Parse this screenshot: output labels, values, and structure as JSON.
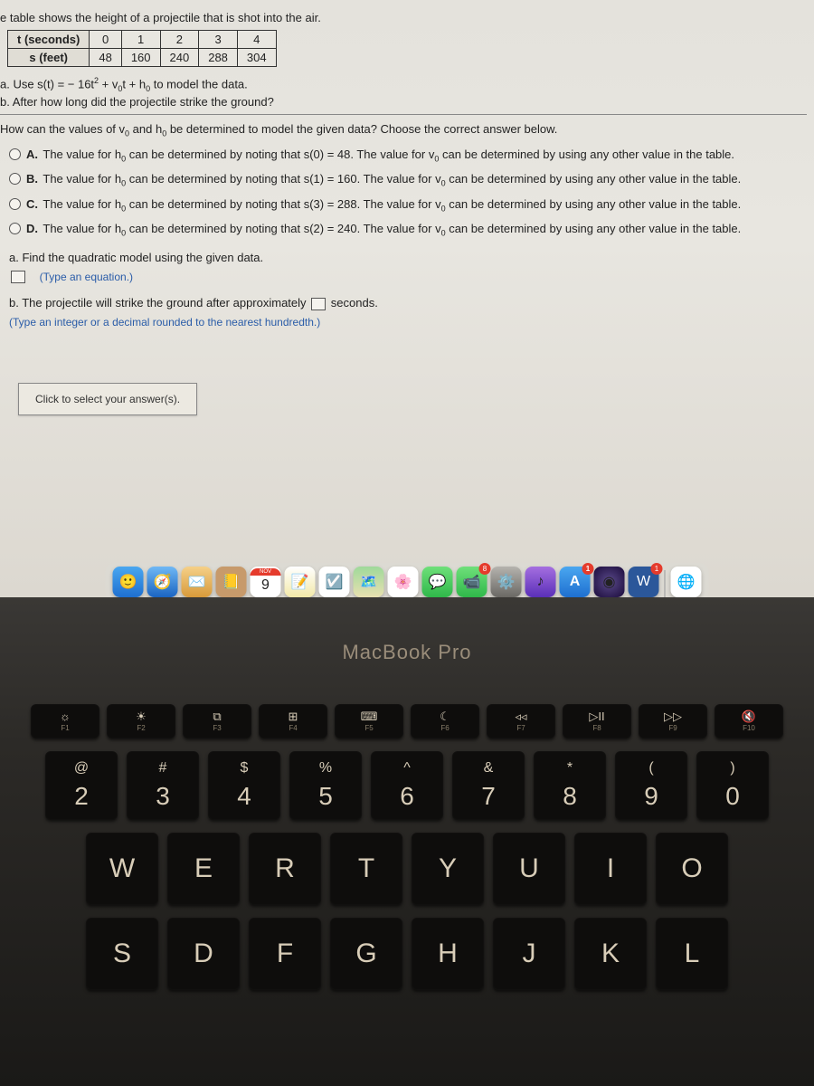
{
  "intro": "e table shows the height of a projectile that is shot into the air.",
  "table": {
    "row1_label": "t (seconds)",
    "row2_label": "s (feet)",
    "cols": [
      "0",
      "1",
      "2",
      "3",
      "4"
    ],
    "vals": [
      "48",
      "160",
      "240",
      "288",
      "304"
    ]
  },
  "part_a_prefix": "a. Use s(t) = − 16t",
  "part_a_mid": " + v",
  "part_a_mid2": "t + h",
  "part_a_suffix": " to model the data.",
  "part_b": "b. After how long did the projectile strike the ground?",
  "question_prefix": "How can the values of v",
  "question_mid": " and h",
  "question_suffix": " be determined to model the given data? Choose the correct answer below.",
  "choices": [
    {
      "l": "A.",
      "p1": "The value for h",
      "p2": " can be determined by noting that s(0) = 48. The value for v",
      "p3": " can be determined by using any other value in the table."
    },
    {
      "l": "B.",
      "p1": "The value for h",
      "p2": " can be determined by noting that s(1) = 160. The value for v",
      "p3": " can be determined by using any other value in the table."
    },
    {
      "l": "C.",
      "p1": "The value for h",
      "p2": " can be determined by noting that s(3) = 288. The value for v",
      "p3": " can be determined by using any other value in the table."
    },
    {
      "l": "D.",
      "p1": "The value for h",
      "p2": " can be determined by noting that s(2) = 240. The value for v",
      "p3": " can be determined by using any other value in the table."
    }
  ],
  "sub_a": "a. Find the quadratic model using the given data.",
  "sub_a_hint": "(Type an equation.)",
  "sub_b_1": "b. The projectile will strike the ground after approximately ",
  "sub_b_2": " seconds.",
  "sub_b_hint": "(Type an integer or a decimal rounded to the nearest hundredth.)",
  "click_msg": "Click to select your answer(s).",
  "zero_sub": "0",
  "two_sup": "2",
  "dock": {
    "cal_month": "NOV",
    "cal_day": "9",
    "badge8": "8",
    "badge1a": "1",
    "badge1b": "1"
  },
  "brand": "MacBook Pro",
  "fkeys": [
    {
      "sym": "☼",
      "lbl": "F1"
    },
    {
      "sym": "☀",
      "lbl": "F2"
    },
    {
      "sym": "⧉",
      "lbl": "F3"
    },
    {
      "sym": "⊞",
      "lbl": "F4"
    },
    {
      "sym": "⌨",
      "lbl": "F5"
    },
    {
      "sym": "☾",
      "lbl": "F6"
    },
    {
      "sym": "◃◃",
      "lbl": "F7"
    },
    {
      "sym": "▷II",
      "lbl": "F8"
    },
    {
      "sym": "▷▷",
      "lbl": "F9"
    },
    {
      "sym": "🔇",
      "lbl": "F10"
    }
  ],
  "numkeys": [
    {
      "t": "@",
      "b": "2"
    },
    {
      "t": "#",
      "b": "3"
    },
    {
      "t": "$",
      "b": "4"
    },
    {
      "t": "%",
      "b": "5"
    },
    {
      "t": "^",
      "b": "6"
    },
    {
      "t": "&",
      "b": "7"
    },
    {
      "t": "*",
      "b": "8"
    },
    {
      "t": "(",
      "b": "9"
    },
    {
      "t": ")",
      "b": "0"
    }
  ],
  "row_qwerty": [
    "W",
    "E",
    "R",
    "T",
    "Y",
    "U",
    "I",
    "O"
  ],
  "row_asdf": [
    "S",
    "D",
    "F",
    "G",
    "H",
    "J",
    "K",
    "L"
  ]
}
